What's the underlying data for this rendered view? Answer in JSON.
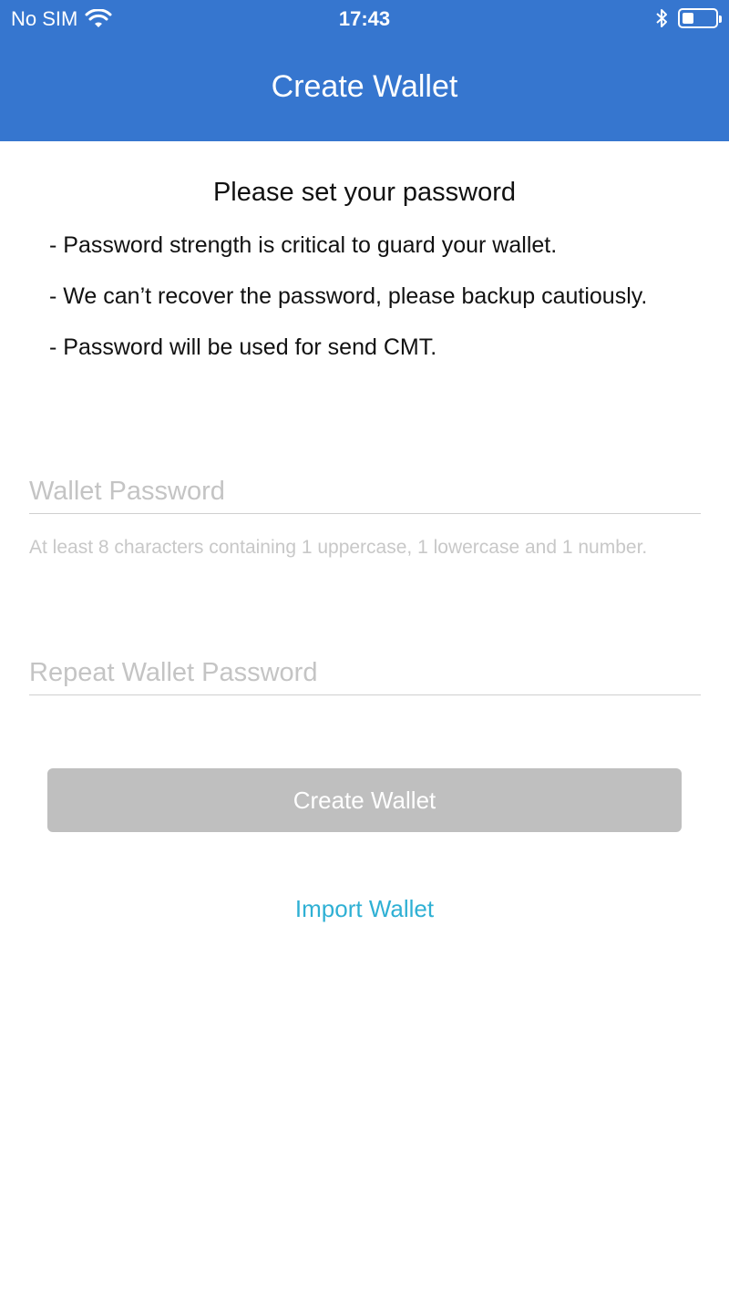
{
  "status_bar": {
    "carrier": "No SIM",
    "time": "17:43",
    "battery_level": 0.35
  },
  "nav": {
    "title": "Create Wallet"
  },
  "intro": {
    "title": "Please set your password",
    "bullets": [
      "- Password strength is critical to guard your wallet.",
      "- We can’t recover the password, please backup cautiously.",
      "- Password will be used for send CMT."
    ]
  },
  "form": {
    "password_placeholder": "Wallet Password",
    "password_value": "",
    "password_hint": "At least 8 characters containing 1 uppercase, 1 lowercase and 1 number.",
    "repeat_placeholder": "Repeat Wallet Password",
    "repeat_value": "",
    "create_label": "Create Wallet",
    "import_label": "Import Wallet"
  },
  "colors": {
    "header": "#3676cf",
    "button_disabled": "#bfbfbf",
    "link": "#2fb0d4"
  }
}
